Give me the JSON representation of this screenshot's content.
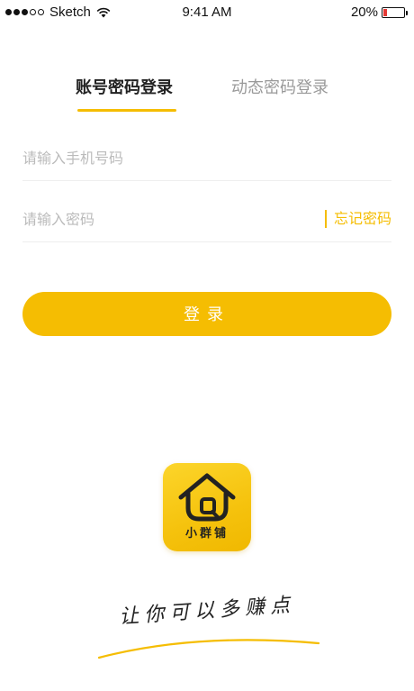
{
  "status_bar": {
    "carrier": "Sketch",
    "time": "9:41 AM",
    "battery_percent": "20%",
    "battery_level": 0.2
  },
  "tabs": [
    {
      "label": "账号密码登录",
      "active": true
    },
    {
      "label": "动态密码登录",
      "active": false
    }
  ],
  "form": {
    "phone_placeholder": "请输入手机号码",
    "password_placeholder": "请输入密码",
    "forgot_label": "忘记密码",
    "login_label": "登录"
  },
  "brand": {
    "logo_text": "小群铺",
    "slogan": "让你可以多赚点",
    "accent_color": "#f5bd02"
  }
}
